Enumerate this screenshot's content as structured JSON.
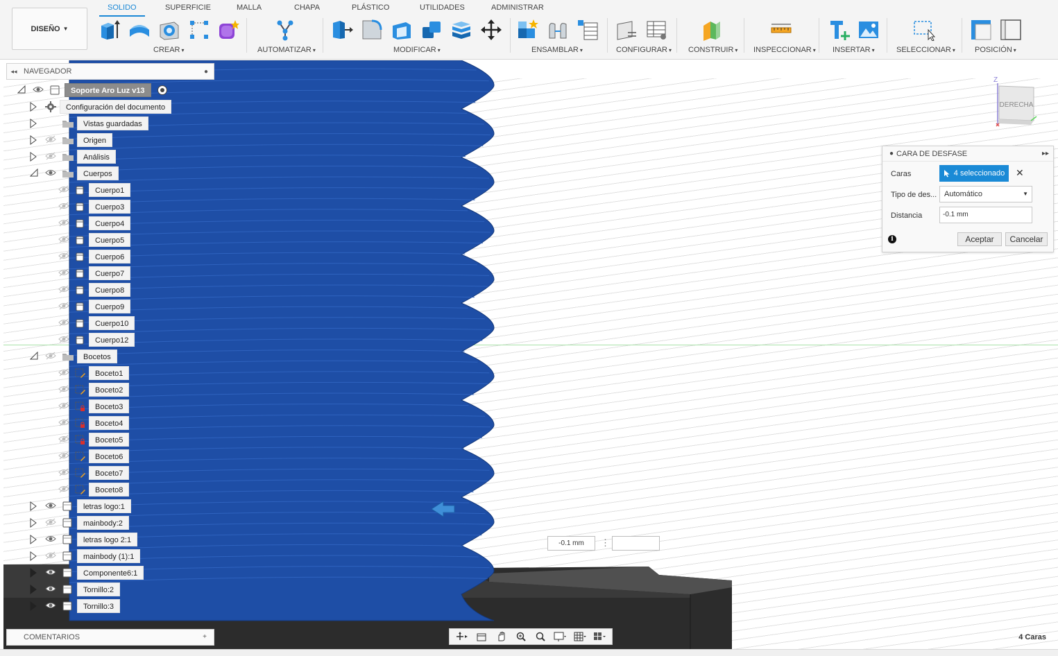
{
  "workspace": {
    "label": "DISEÑO",
    "caret": "▼"
  },
  "tabs": [
    "SOLIDO",
    "SUPERFICIE",
    "MALLA",
    "CHAPA",
    "PLÁSTICO",
    "UTILIDADES",
    "ADMINISTRAR"
  ],
  "toolbar_groups": [
    "CREAR",
    "AUTOMATIZAR",
    "MODIFICAR",
    "ENSAMBLAR",
    "CONFIGURAR",
    "CONSTRUIR",
    "INSPECCIONAR",
    "INSERTAR",
    "SELECCIONAR",
    "POSICIÓN"
  ],
  "group_caret": "▾",
  "browser": {
    "title": "NAVEGADOR",
    "collapse_glyph": "◂◂",
    "min_glyph": "●",
    "root": "Soporte Aro Luz v13",
    "items": [
      "Configuración del documento",
      "Vistas guardadas",
      "Origen",
      "Análisis",
      "Cuerpos",
      "Cuerpo1",
      "Cuerpo3",
      "Cuerpo4",
      "Cuerpo5",
      "Cuerpo6",
      "Cuerpo7",
      "Cuerpo8",
      "Cuerpo9",
      "Cuerpo10",
      "Cuerpo12",
      "Bocetos",
      "Boceto1",
      "Boceto2",
      "Boceto3",
      "Boceto4",
      "Boceto5",
      "Boceto6",
      "Boceto7",
      "Boceto8",
      "letras logo:1",
      "mainbody:2",
      "letras logo 2:1",
      "mainbody (1):1",
      "Componente6:1",
      "Tornillo:2",
      "Tornillo:3"
    ]
  },
  "comments": {
    "label": "COMENTARIOS",
    "plus": "+"
  },
  "dialog": {
    "title": "CARA DE DESFASE",
    "faces_label": "Caras",
    "faces_value": "4 seleccionado",
    "offset_type_label": "Tipo de des...",
    "offset_type_value": "Automático",
    "distance_label": "Distancia",
    "distance_value": "-0.1 mm",
    "accept": "Aceptar",
    "cancel": "Cancelar",
    "clear_glyph": "✕",
    "expand_glyph": "▸▸",
    "info_glyph": "i"
  },
  "viewcube_label": "DERECHA",
  "viewcube_axis": "Z",
  "dimension_box": "-0.1 mm",
  "status_text": "4 Caras",
  "colors": {
    "accent": "#1a88d6",
    "body_blue": "#1e4ea6",
    "base_dark": "#2d2d2d",
    "selected_btn": "#1a8ad6"
  },
  "icons": [
    "gear-icon",
    "folder-icon",
    "eye-icon",
    "body-icon",
    "sketch-icon",
    "component-icon",
    "arrow-left-icon",
    "orbit-icon",
    "pan-icon",
    "zoom-icon",
    "display-icon",
    "grid-icon",
    "viewports-icon"
  ]
}
